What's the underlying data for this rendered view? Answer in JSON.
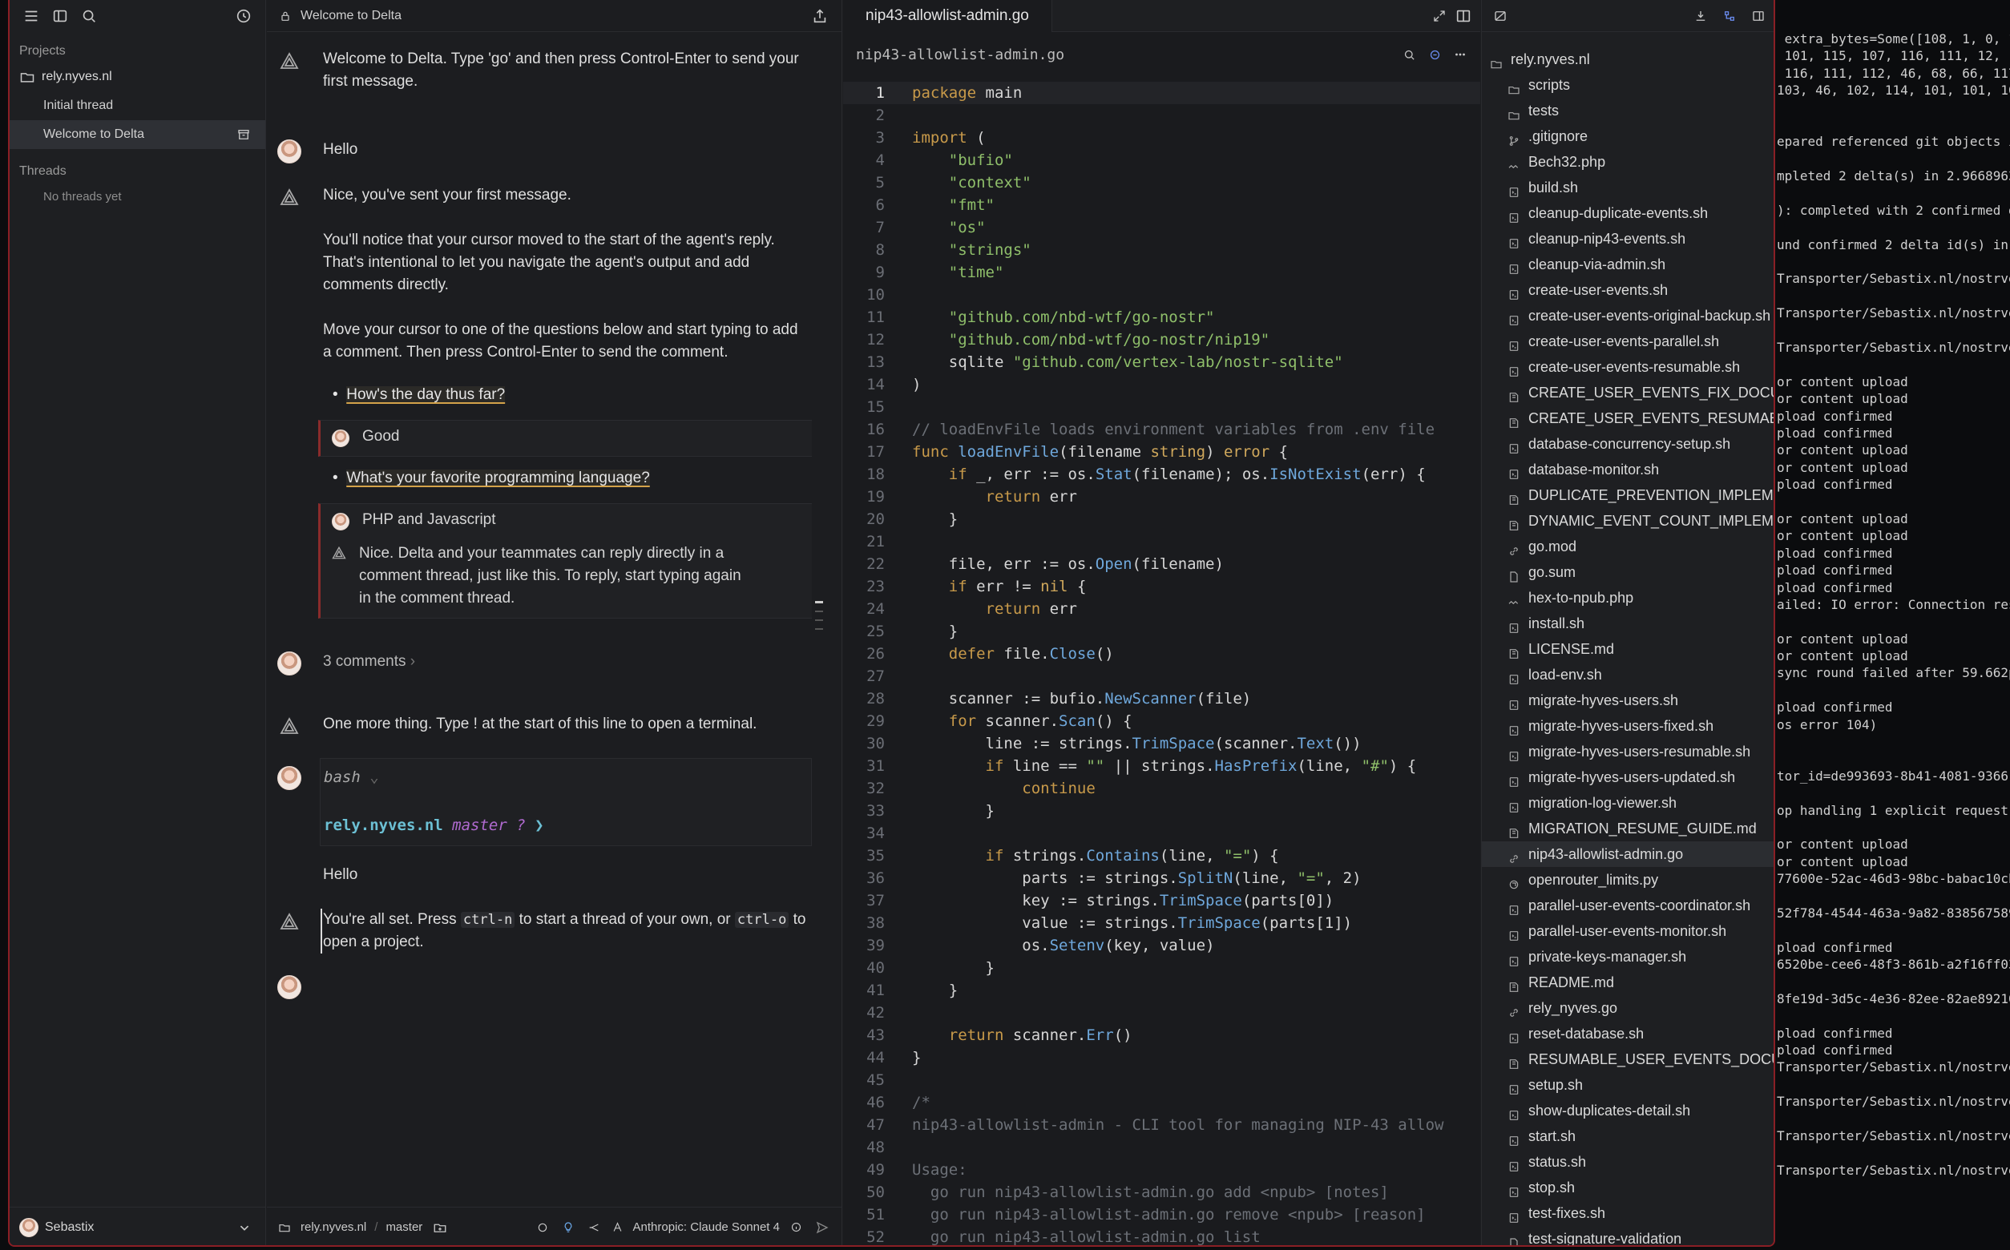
{
  "sidebar": {
    "projects_header": "Projects",
    "project_name": "rely.nyves.nl",
    "threads": [
      "Initial thread",
      "Welcome to Delta"
    ],
    "threads_header": "Threads",
    "no_threads": "No threads yet",
    "user": "Sebastix"
  },
  "chat": {
    "tab_title": "Welcome to Delta",
    "welcome": "Welcome to Delta. Type 'go' and then press Control-Enter to send your first message.",
    "hello": "Hello",
    "nice": "Nice, you've sent your first message.",
    "cursor_note": "You'll notice that your cursor moved to the start of the agent's reply. That's intentional to let you navigate the agent's output and add comments directly.",
    "move_note": "Move your cursor to one of the questions below and start typing to add a comment. Then press Control-Enter to send the comment.",
    "q1": "How's the day thus far?",
    "q1_answer": "Good",
    "q2": "What's your favorite programming language?",
    "q2_answer": "PHP and Javascript",
    "q2_reply": "Nice. Delta and your teammates can reply directly in a comment thread, just like this. To reply, start typing again in the comment thread.",
    "comments": "3 comments",
    "one_more": "One more thing. Type ! at the start of this line to open a terminal.",
    "shell": "bash",
    "prompt_host": "rely.nyves.nl",
    "prompt_branch": "master ?",
    "prompt_arrow": "❯",
    "hello2": "Hello",
    "final_1": "You're all set. Press",
    "final_k1": "ctrl-n",
    "final_2": "to start a thread of your own, or",
    "final_k2": "ctrl-o",
    "final_3": "to open a project.",
    "footer_project": "rely.nyves.nl",
    "footer_branch": "master",
    "footer_model": "Anthropic: Claude Sonnet 4"
  },
  "editor": {
    "tab": "nip43-allowlist-admin.go",
    "breadcrumb": "nip43-allowlist-admin.go",
    "lines": [
      "package main",
      "",
      "import (",
      "    \"bufio\"",
      "    \"context\"",
      "    \"fmt\"",
      "    \"os\"",
      "    \"strings\"",
      "    \"time\"",
      "",
      "    \"github.com/nbd-wtf/go-nostr\"",
      "    \"github.com/nbd-wtf/go-nostr/nip19\"",
      "    sqlite \"github.com/vertex-lab/nostr-sqlite\"",
      ")",
      "",
      "// loadEnvFile loads environment variables from .env file",
      "func loadEnvFile(filename string) error {",
      "    if _, err := os.Stat(filename); os.IsNotExist(err) {",
      "        return err",
      "    }",
      "",
      "    file, err := os.Open(filename)",
      "    if err != nil {",
      "        return err",
      "    }",
      "    defer file.Close()",
      "",
      "    scanner := bufio.NewScanner(file)",
      "    for scanner.Scan() {",
      "        line := strings.TrimSpace(scanner.Text())",
      "        if line == \"\" || strings.HasPrefix(line, \"#\") {",
      "            continue",
      "        }",
      "",
      "        if strings.Contains(line, \"=\") {",
      "            parts := strings.SplitN(line, \"=\", 2)",
      "            key := strings.TrimSpace(parts[0])",
      "            value := strings.TrimSpace(parts[1])",
      "            os.Setenv(key, value)",
      "        }",
      "    }",
      "",
      "    return scanner.Err()",
      "}",
      "",
      "/*",
      "nip43-allowlist-admin - CLI tool for managing NIP-43 allow",
      "",
      "Usage:",
      "  go run nip43-allowlist-admin.go add <npub> [notes]",
      "  go run nip43-allowlist-admin.go remove <npub> [reason]",
      "  go run nip43-allowlist-admin.go list"
    ]
  },
  "tree": {
    "root": "rely.nyves.nl",
    "items": [
      {
        "name": "scripts",
        "icon": "folder-icon"
      },
      {
        "name": "tests",
        "icon": "folder-icon"
      },
      {
        "name": ".gitignore",
        "icon": "git-icon"
      },
      {
        "name": "Bech32.php",
        "icon": "php-icon"
      },
      {
        "name": "build.sh",
        "icon": "file-icon"
      },
      {
        "name": "cleanup-duplicate-events.sh",
        "icon": "file-icon"
      },
      {
        "name": "cleanup-nip43-events.sh",
        "icon": "file-icon"
      },
      {
        "name": "cleanup-via-admin.sh",
        "icon": "file-icon"
      },
      {
        "name": "create-user-events.sh",
        "icon": "file-icon"
      },
      {
        "name": "create-user-events-original-backup.sh",
        "icon": "file-icon"
      },
      {
        "name": "create-user-events-parallel.sh",
        "icon": "file-icon"
      },
      {
        "name": "create-user-events-resumable.sh",
        "icon": "file-icon"
      },
      {
        "name": "CREATE_USER_EVENTS_FIX_DOCUMENTATION.md",
        "icon": "book-icon"
      },
      {
        "name": "CREATE_USER_EVENTS_RESUMABLE.md",
        "icon": "book-icon"
      },
      {
        "name": "database-concurrency-setup.sh",
        "icon": "file-icon"
      },
      {
        "name": "database-monitor.sh",
        "icon": "file-icon"
      },
      {
        "name": "DUPLICATE_PREVENTION_IMPLEMENTATION.md",
        "icon": "book-icon"
      },
      {
        "name": "DYNAMIC_EVENT_COUNT_IMPLEMENTATION.md",
        "icon": "book-icon"
      },
      {
        "name": "go.mod",
        "icon": "link-icon"
      },
      {
        "name": "go.sum",
        "icon": "doc-icon"
      },
      {
        "name": "hex-to-npub.php",
        "icon": "php-icon"
      },
      {
        "name": "install.sh",
        "icon": "file-icon"
      },
      {
        "name": "LICENSE.md",
        "icon": "book-icon"
      },
      {
        "name": "load-env.sh",
        "icon": "file-icon"
      },
      {
        "name": "migrate-hyves-users.sh",
        "icon": "file-icon"
      },
      {
        "name": "migrate-hyves-users-fixed.sh",
        "icon": "file-icon"
      },
      {
        "name": "migrate-hyves-users-resumable.sh",
        "icon": "file-icon"
      },
      {
        "name": "migrate-hyves-users-updated.sh",
        "icon": "file-icon"
      },
      {
        "name": "migration-log-viewer.sh",
        "icon": "file-icon"
      },
      {
        "name": "MIGRATION_RESUME_GUIDE.md",
        "icon": "book-icon"
      },
      {
        "name": "nip43-allowlist-admin.go",
        "icon": "link-icon",
        "selected": true
      },
      {
        "name": "openrouter_limits.py",
        "icon": "python-icon"
      },
      {
        "name": "parallel-user-events-coordinator.sh",
        "icon": "file-icon"
      },
      {
        "name": "parallel-user-events-monitor.sh",
        "icon": "file-icon"
      },
      {
        "name": "private-keys-manager.sh",
        "icon": "file-icon"
      },
      {
        "name": "README.md",
        "icon": "book-icon"
      },
      {
        "name": "rely_nyves.go",
        "icon": "link-icon"
      },
      {
        "name": "reset-database.sh",
        "icon": "file-icon"
      },
      {
        "name": "RESUMABLE_USER_EVENTS_DOCUMENTATION.md",
        "icon": "book-icon"
      },
      {
        "name": "setup.sh",
        "icon": "file-icon"
      },
      {
        "name": "show-duplicates-detail.sh",
        "icon": "file-icon"
      },
      {
        "name": "start.sh",
        "icon": "file-icon"
      },
      {
        "name": "status.sh",
        "icon": "file-icon"
      },
      {
        "name": "stop.sh",
        "icon": "file-icon"
      },
      {
        "name": "test-fixes.sh",
        "icon": "file-icon"
      },
      {
        "name": "test-signature-validation",
        "icon": "doc-icon"
      }
    ]
  },
  "terminal": {
    "lines": [
      " extra_bytes=Some([108, 1, 0, 1,",
      " 101, 115, 107, 116, 111, 12,",
      " 116, 111, 112, 46, 68, 66, 117,",
      "103, 46, 102, 114, 101, 101, 100",
      "",
      "",
      "epared referenced git objects in",
      "",
      "mpleted 2 delta(s) in 2.96689637",
      "",
      "): completed with 2 confirmed de",
      "",
      "und confirmed 2 delta id(s) in 4",
      "",
      "Transporter/Sebastix.nl/nostrver",
      "",
      "Transporter/Sebastix.nl/nostrver",
      "",
      "Transporter/Sebastix.nl/nostrver",
      "",
      "or content upload",
      "or content upload",
      "pload confirmed",
      "pload confirmed",
      "or content upload",
      "or content upload",
      "pload confirmed",
      "",
      "or content upload",
      "or content upload",
      "pload confirmed",
      "pload confirmed",
      "pload confirmed",
      "ailed: IO error: Connection rese",
      "",
      "or content upload",
      "or content upload",
      "sync round failed after 59.662µs",
      "",
      "pload confirmed",
      "os error 104)",
      "",
      "",
      "tor_id=de993693-8b41-4081-9366-2",
      "",
      "op handling 1 explicit request(s",
      "",
      "or content upload",
      "or content upload",
      "77600e-52ac-46d3-98bc-babac10cbl",
      "",
      "52f784-4544-463a-9a82-8385675898",
      "",
      "pload confirmed",
      "6520be-cee6-48f3-861b-a2f16ff03c",
      "",
      "8fe19d-3d5c-4e36-82ee-82ae89210a",
      "",
      "pload confirmed",
      "pload confirmed",
      "Transporter/Sebastix.nl/nostrver",
      "",
      "Transporter/Sebastix.nl/nostrver",
      "",
      "Transporter/Sebastix.nl/nostrver",
      "",
      "Transporter/Sebastix.nl/nostrver"
    ]
  }
}
